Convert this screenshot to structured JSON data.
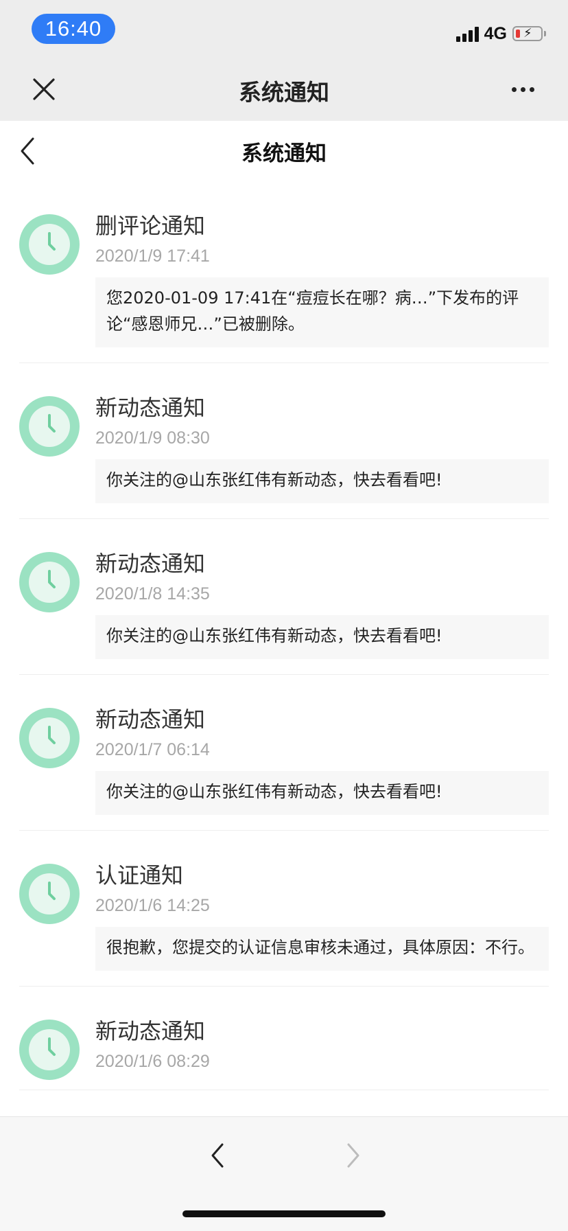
{
  "status_bar": {
    "time": "16:40",
    "network": "4G",
    "icons": [
      "signal-icon",
      "battery-charging-icon"
    ],
    "battery_color": "#e53935"
  },
  "webview_header": {
    "title": "系统通知",
    "close_icon": "close-icon",
    "more_icon": "more-icon"
  },
  "page_header": {
    "title": "系统通知",
    "back_icon": "chevron-left-icon"
  },
  "colors": {
    "accent": "#2f7cf6",
    "avatar_bg": "#9be2c2",
    "avatar_face": "#e7f7ef",
    "avatar_hand": "#6fcf9f"
  },
  "notifications": [
    {
      "title": "删评论通知",
      "time": "2020/1/9 17:41",
      "message": "您2020-01-09 17:41在“痘痘长在哪？病…”下发布的评论“感恩师兄…”已被删除。"
    },
    {
      "title": "新动态通知",
      "time": "2020/1/9 08:30",
      "message": "你关注的@山东张红伟有新动态，快去看看吧!"
    },
    {
      "title": "新动态通知",
      "time": "2020/1/8 14:35",
      "message": "你关注的@山东张红伟有新动态，快去看看吧!"
    },
    {
      "title": "新动态通知",
      "time": "2020/1/7 06:14",
      "message": "你关注的@山东张红伟有新动态，快去看看吧!"
    },
    {
      "title": "认证通知",
      "time": "2020/1/6 14:25",
      "message": "很抱歉，您提交的认证信息审核未通过，具体原因：不行。"
    },
    {
      "title": "新动态通知",
      "time": "2020/1/6 08:29",
      "message": ""
    }
  ],
  "bottom_bar": {
    "back_icon": "chevron-left-icon",
    "forward_icon": "chevron-right-icon"
  }
}
